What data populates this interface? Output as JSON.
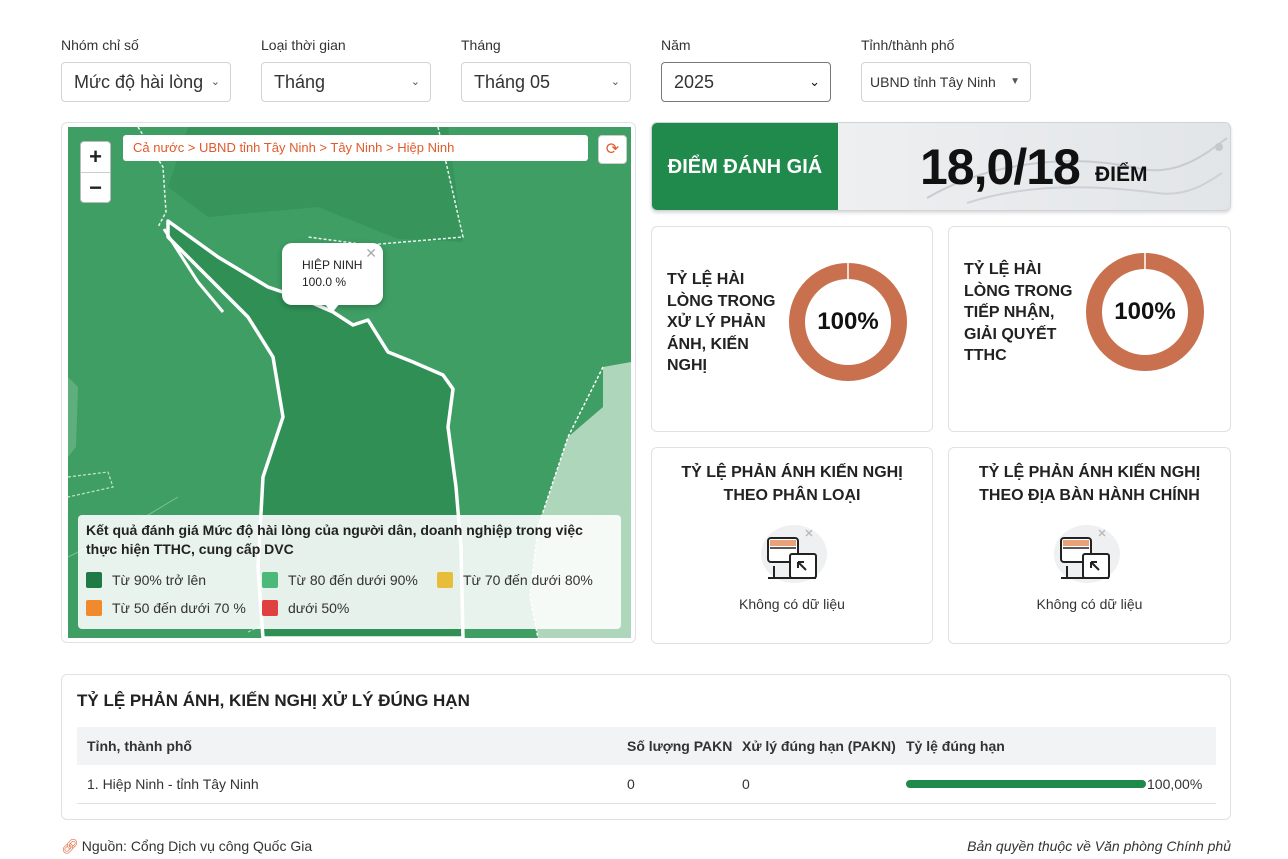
{
  "filters": [
    {
      "label": "Nhóm chỉ số",
      "value": "Mức độ hài lòng"
    },
    {
      "label": "Loại thời gian",
      "value": "Tháng"
    },
    {
      "label": "Tháng",
      "value": "Tháng 05"
    },
    {
      "label": "Năm",
      "value": "2025"
    },
    {
      "label": "Tỉnh/thành phố",
      "value": "UBND tỉnh Tây Ninh"
    }
  ],
  "map": {
    "breadcrumb": "Cả nước > UBND tỉnh Tây Ninh > Tây Ninh > Hiệp Ninh",
    "zoom_in": "+",
    "zoom_out": "−",
    "popup": {
      "name": "HIỆP NINH",
      "value": "100.0 %"
    },
    "fill_color": "#3e9e63",
    "legend": {
      "title": "Kết quả đánh giá Mức độ hài lòng của người dân, doanh nghiệp trong việc thực hiện TTHC, cung cấp DVC",
      "items": [
        {
          "label": "Từ 90% trở lên",
          "color": "#1f7a45"
        },
        {
          "label": "Từ 80 đến dưới 90%",
          "color": "#4cb87a"
        },
        {
          "label": "Từ 70 đến dưới 80%",
          "color": "#e8bd3c"
        },
        {
          "label": "Từ 50 đến dưới 70 %",
          "color": "#f08a2c"
        },
        {
          "label": "dưới 50%",
          "color": "#e04040"
        }
      ]
    }
  },
  "score": {
    "label": "ĐIỂM ĐÁNH GIÁ",
    "value": "18,0/18",
    "unit": "ĐIỂM"
  },
  "satisfaction": [
    {
      "title": "Tỷ lệ hài lòng trong xử lý phản ánh, kiến nghị",
      "percent_label": "100%",
      "percent": 100,
      "color": "#c9714f"
    },
    {
      "title": "Tỷ lệ hài lòng trong tiếp nhận, giải quyết TTHC",
      "percent_label": "100%",
      "percent": 100,
      "color": "#c9714f"
    }
  ],
  "feedback": [
    {
      "title": "TỶ LỆ PHẢN ÁNH KIẾN NGHỊ THEO PHÂN LOẠI",
      "empty": "Không có dữ liệu"
    },
    {
      "title": "TỶ LỆ PHẢN ÁNH KIẾN NGHỊ THEO ĐỊA BÀN HÀNH CHÍNH",
      "empty": "Không có dữ liệu"
    }
  ],
  "table": {
    "title": "TỶ LỆ PHẢN ÁNH, KIẾN NGHỊ XỬ LÝ ĐÚNG HẠN",
    "columns": [
      "Tỉnh, thành phố",
      "Số lượng PAKN",
      "Xử lý đúng hạn (PAKN)",
      "Tỷ lệ đúng hạn"
    ],
    "rows": [
      {
        "name": "1. Hiệp Ninh - tỉnh Tây Ninh",
        "count": "0",
        "on_time": "0",
        "rate_label": "100,00%",
        "rate": 100
      }
    ]
  },
  "footer": {
    "source": "Nguồn: Cổng Dịch vụ công Quốc Gia",
    "copyright": "Bản quyền thuộc về Văn phòng Chính phủ"
  }
}
